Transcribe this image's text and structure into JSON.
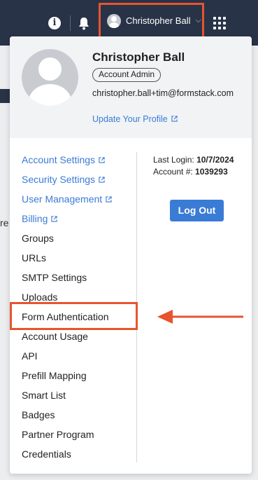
{
  "topbar": {
    "info_icon": "i",
    "user_button_label": "Christopher Ball",
    "caret": "⌵"
  },
  "profile": {
    "name": "Christopher Ball",
    "role": "Account Admin",
    "email": "christopher.ball+tim@formstack.com",
    "update_link": "Update Your Profile"
  },
  "menu": {
    "items": [
      {
        "label": "Account Settings",
        "external": true
      },
      {
        "label": "Security Settings",
        "external": true
      },
      {
        "label": "User Management",
        "external": true
      },
      {
        "label": "Billing",
        "external": true
      },
      {
        "label": "Groups",
        "external": false
      },
      {
        "label": "URLs",
        "external": false
      },
      {
        "label": "SMTP Settings",
        "external": false
      },
      {
        "label": "Uploads",
        "external": false
      },
      {
        "label": "Form Authentication",
        "external": false
      },
      {
        "label": "Account Usage",
        "external": false
      },
      {
        "label": "API",
        "external": false
      },
      {
        "label": "Prefill Mapping",
        "external": false
      },
      {
        "label": "Smart List",
        "external": false
      },
      {
        "label": "Badges",
        "external": false
      },
      {
        "label": "Partner Program",
        "external": false
      },
      {
        "label": "Credentials",
        "external": false
      }
    ]
  },
  "account": {
    "last_login_label": "Last Login:",
    "last_login_value": "10/7/2024",
    "account_num_label": "Account #:",
    "account_num_value": "1039293",
    "logout_label": "Log Out"
  },
  "background_text": "re",
  "colors": {
    "topbar": "#283347",
    "link": "#3a7bd5",
    "highlight": "#e8542e"
  }
}
